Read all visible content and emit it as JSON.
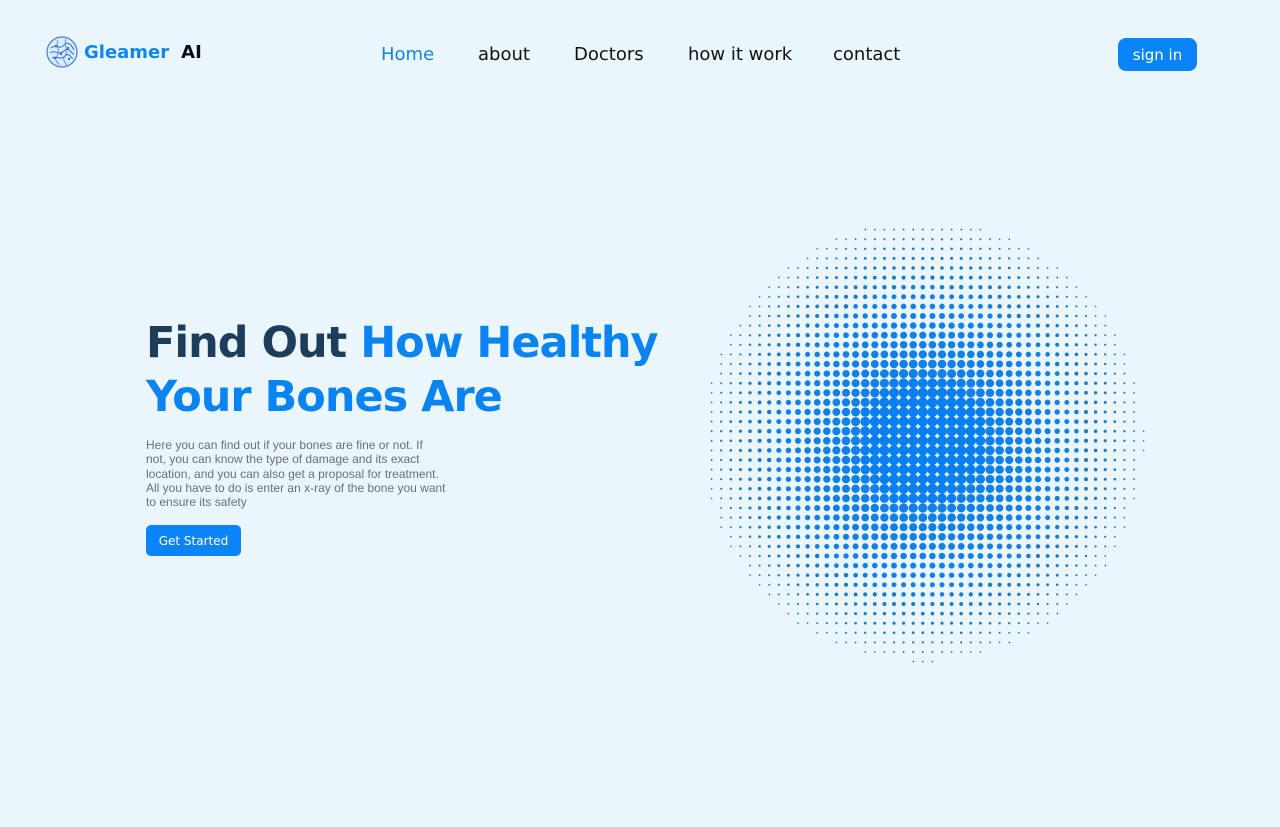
{
  "brand": {
    "name": "Gleamer",
    "suffix": "AI",
    "icon": "brain-globe-icon"
  },
  "nav": {
    "items": [
      {
        "label": "Home",
        "active": true
      },
      {
        "label": "about",
        "active": false
      },
      {
        "label": "Doctors",
        "active": false
      },
      {
        "label": "how it work",
        "active": false
      },
      {
        "label": "contact",
        "active": false
      }
    ]
  },
  "header": {
    "signin_label": "sign in"
  },
  "hero": {
    "title_dark": "Find Out",
    "title_blue_1": "How Healthy",
    "title_blue_2": "Your Bones Are",
    "description": "Here you can find out if your bones are fine or not. If not, you can know the type of damage and its exact location, and you can also get a proposal for treatment. All you have to do is enter an x-ray of the bone you want to ensure its safety",
    "cta_label": "Get Started"
  },
  "colors": {
    "background": "#EAF6FC",
    "accent": "#0A84F8",
    "title_dark": "#1D3D5C",
    "title_blue": "#0A84F0"
  }
}
